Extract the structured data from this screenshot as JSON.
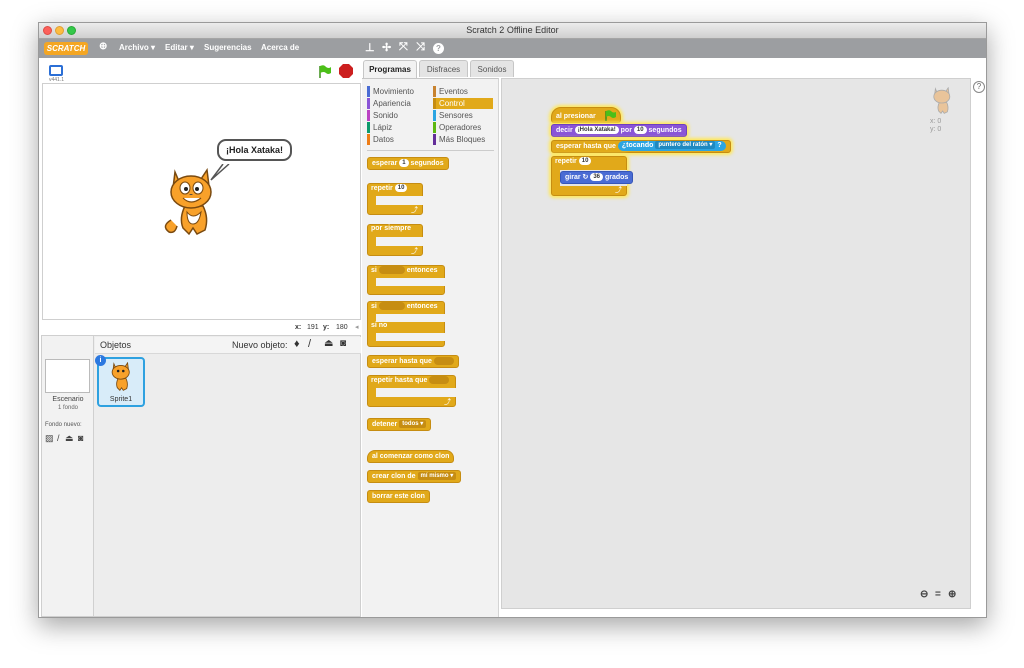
{
  "window": {
    "title": "Scratch 2 Offline Editor"
  },
  "menubar": {
    "logo": "SCRATCH",
    "items": [
      "Archivo ▾",
      "Editar ▾",
      "Sugerencias",
      "Acerca de"
    ]
  },
  "stage": {
    "version": "v441.1",
    "speech": "¡Hola Xataka!",
    "x_label": "x:",
    "x_value": "191",
    "y_label": "y:",
    "y_value": "180"
  },
  "sprites": {
    "header": "Objetos",
    "new_object_label": "Nuevo objeto:",
    "stage_label": "Escenario",
    "stage_sub": "1 fondo",
    "new_backdrop_label": "Fondo nuevo:",
    "sprite_name": "Sprite1"
  },
  "tabs": [
    "Programas",
    "Disfraces",
    "Sonidos"
  ],
  "categories": {
    "left": [
      {
        "label": "Movimiento",
        "color": "#4a6cd4"
      },
      {
        "label": "Apariencia",
        "color": "#8a55d7"
      },
      {
        "label": "Sonido",
        "color": "#bb42c3"
      },
      {
        "label": "Lápiz",
        "color": "#0e9a6c"
      },
      {
        "label": "Datos",
        "color": "#ee7d16"
      }
    ],
    "right": [
      {
        "label": "Eventos",
        "color": "#c88330"
      },
      {
        "label": "Control",
        "color": "#e1a91a"
      },
      {
        "label": "Sensores",
        "color": "#2ca5e2"
      },
      {
        "label": "Operadores",
        "color": "#5cb712"
      },
      {
        "label": "Más Bloques",
        "color": "#632d99"
      }
    ]
  },
  "palette": {
    "wait_a": "esperar",
    "wait_num": "1",
    "wait_b": "segundos",
    "repeat": "repetir",
    "repeat_num": "10",
    "forever": "por siempre",
    "if_a": "si",
    "if_b": "entonces",
    "ifelse_a": "si",
    "ifelse_b": "entonces",
    "else": "si no",
    "wait_until": "esperar hasta que",
    "repeat_until": "repetir hasta que",
    "stop": "detener",
    "stop_opt": "todos",
    "clone_start": "al comenzar como clon",
    "create_clone": "crear clon de",
    "create_clone_opt": "mí mismo",
    "delete_clone": "borrar este clon"
  },
  "script": {
    "hat": "al presionar",
    "say_a": "decir",
    "say_text": "¡Hola Xataka!",
    "say_b": "por",
    "say_num": "10",
    "say_c": "segundos",
    "wait_a": "esperar hasta que",
    "touching": "¿tocando",
    "touching_opt": "puntero del ratón",
    "repeat": "repetir",
    "repeat_num": "10",
    "turn_a": "girar",
    "turn_num": "36",
    "turn_b": "grados"
  },
  "sprite_info": {
    "x": "x: 0",
    "y": "y: 0"
  },
  "zoom": {
    "equal": "="
  },
  "colors": {
    "control": "#e1a91a",
    "looks": "#8a55d7",
    "sensing": "#2ca5e2",
    "motion": "#4a6cd4"
  }
}
